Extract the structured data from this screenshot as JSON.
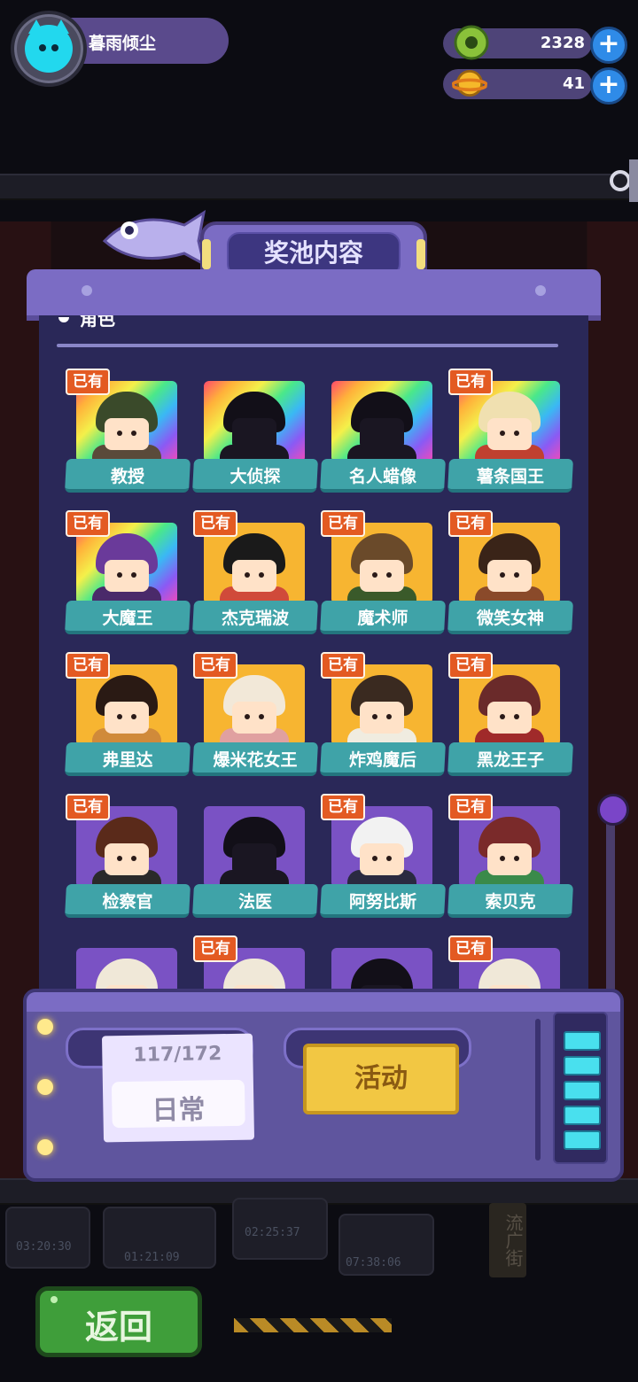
{
  "player": {
    "name": "暮雨倾尘"
  },
  "currencies": [
    {
      "name": "gems",
      "value": "2328",
      "icon": "green-donut-icon"
    },
    {
      "name": "coins",
      "value": "41",
      "icon": "gold-planet-icon"
    }
  ],
  "panel": {
    "title": "奖池内容",
    "section_title": "角色",
    "owned_label": "已有",
    "cards": [
      {
        "name": "教授",
        "owned": true,
        "frame": "rainbow",
        "silhouette": false
      },
      {
        "name": "大侦探",
        "owned": false,
        "frame": "rainbow",
        "silhouette": true
      },
      {
        "name": "名人蜡像",
        "owned": false,
        "frame": "rainbow",
        "silhouette": true
      },
      {
        "name": "薯条国王",
        "owned": true,
        "frame": "rainbow",
        "silhouette": false
      },
      {
        "name": "大魔王",
        "owned": true,
        "frame": "rainbow",
        "silhouette": false
      },
      {
        "name": "杰克瑞波",
        "owned": true,
        "frame": "gold",
        "silhouette": false
      },
      {
        "name": "魔术师",
        "owned": true,
        "frame": "gold",
        "silhouette": false
      },
      {
        "name": "微笑女神",
        "owned": true,
        "frame": "gold",
        "silhouette": false
      },
      {
        "name": "弗里达",
        "owned": true,
        "frame": "gold",
        "silhouette": false
      },
      {
        "name": "爆米花女王",
        "owned": true,
        "frame": "gold",
        "silhouette": false
      },
      {
        "name": "炸鸡魔后",
        "owned": true,
        "frame": "gold",
        "silhouette": false
      },
      {
        "name": "黑龙王子",
        "owned": true,
        "frame": "gold",
        "silhouette": false
      },
      {
        "name": "检察官",
        "owned": true,
        "frame": "purple",
        "silhouette": false
      },
      {
        "name": "法医",
        "owned": false,
        "frame": "purple",
        "silhouette": true
      },
      {
        "name": "阿努比斯",
        "owned": true,
        "frame": "purple",
        "silhouette": false
      },
      {
        "name": "索贝克",
        "owned": true,
        "frame": "purple",
        "silhouette": false
      },
      {
        "name": "",
        "owned": false,
        "frame": "purple",
        "silhouette": false
      },
      {
        "name": "",
        "owned": true,
        "frame": "purple",
        "silhouette": false
      },
      {
        "name": "",
        "owned": false,
        "frame": "purple",
        "silhouette": true
      },
      {
        "name": "",
        "owned": true,
        "frame": "purple",
        "silhouette": false
      }
    ]
  },
  "tabs": {
    "daily": {
      "label": "日常",
      "progress": "117/172"
    },
    "event": {
      "label": "活动"
    }
  },
  "backdrop": {
    "timers": [
      "03:20:30",
      "01:21:09",
      "02:25:37",
      "07:38:06"
    ],
    "sign": "流广街"
  },
  "back_button": {
    "label": "返回"
  },
  "colors": {
    "accent": "#7b6cc4",
    "panel": "#2a2858",
    "owned_badge": "#e35a22",
    "name_banner": "#3fa3a8"
  }
}
